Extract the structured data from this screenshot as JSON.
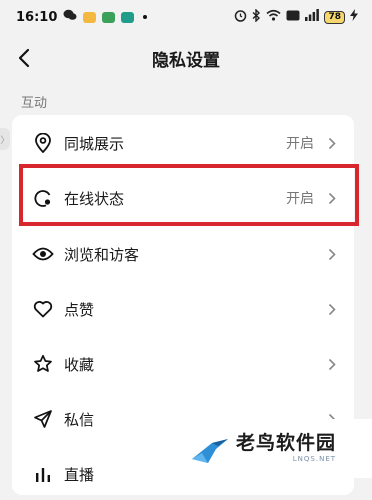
{
  "status_bar": {
    "time": "16:10",
    "battery": "78"
  },
  "header": {
    "title": "隐私设置"
  },
  "section": {
    "label": "互动"
  },
  "items": [
    {
      "label": "同城展示",
      "value": "开启",
      "icon": "location-pin-icon"
    },
    {
      "label": "在线状态",
      "value": "开启",
      "icon": "online-status-icon"
    },
    {
      "label": "浏览和访客",
      "value": "",
      "icon": "eye-icon"
    },
    {
      "label": "点赞",
      "value": "",
      "icon": "heart-icon"
    },
    {
      "label": "收藏",
      "value": "",
      "icon": "star-icon"
    },
    {
      "label": "私信",
      "value": "",
      "icon": "send-icon"
    },
    {
      "label": "直播",
      "value": "",
      "icon": "live-bars-icon"
    }
  ],
  "watermark": {
    "main": "老鸟软件园",
    "sub": "LNQS.NET"
  },
  "colors": {
    "highlight": "#d8262f",
    "background": "#f2f2f2",
    "card": "#ffffff"
  }
}
